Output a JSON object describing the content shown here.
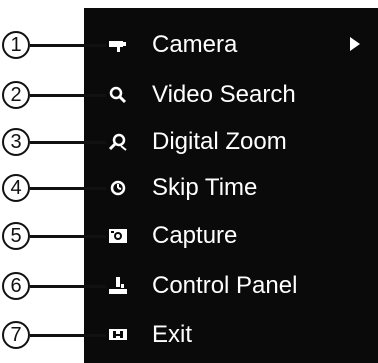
{
  "menu": {
    "items": [
      {
        "label": "Camera",
        "icon": "camera-icon",
        "callout": "1",
        "has_submenu": true
      },
      {
        "label": "Video Search",
        "icon": "search-icon",
        "callout": "2",
        "has_submenu": false
      },
      {
        "label": "Digital Zoom",
        "icon": "zoom-icon",
        "callout": "3",
        "has_submenu": false
      },
      {
        "label": "Skip Time",
        "icon": "clock-icon",
        "callout": "4",
        "has_submenu": false
      },
      {
        "label": "Capture",
        "icon": "capture-icon",
        "callout": "5",
        "has_submenu": false
      },
      {
        "label": "Control Panel",
        "icon": "control-panel-icon",
        "callout": "6",
        "has_submenu": false
      },
      {
        "label": "Exit",
        "icon": "exit-icon",
        "callout": "7",
        "has_submenu": false
      }
    ]
  },
  "colors": {
    "panel_background": "#0a0a0a",
    "menu_text": "#ffffff",
    "callout_ink": "#111111"
  }
}
